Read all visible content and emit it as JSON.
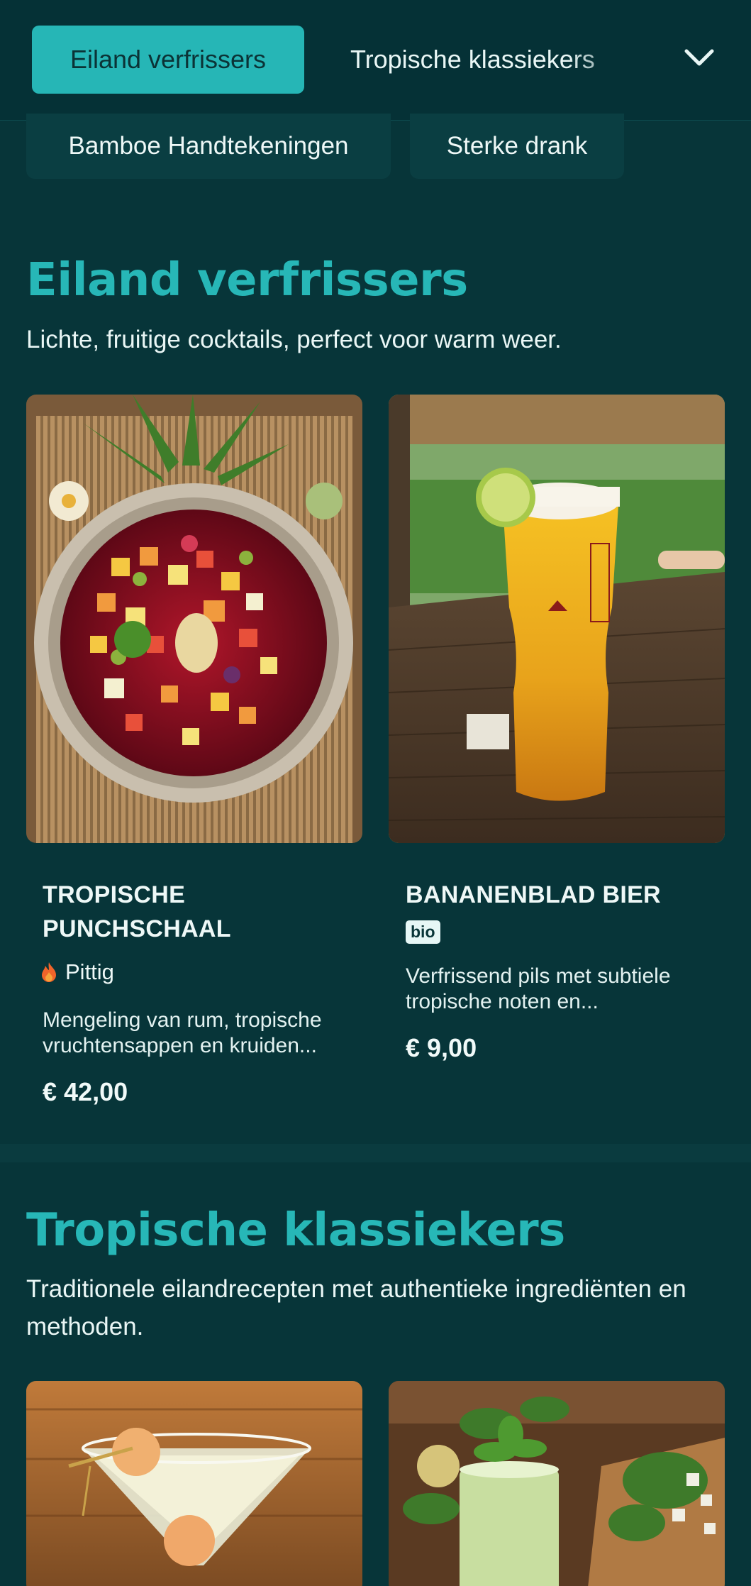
{
  "nav": {
    "active_tab": "Eiland verfrissers",
    "next_tab": "Tropische klassiekers",
    "chips": [
      "Bamboe Handtekeningen",
      "Sterke drank"
    ]
  },
  "sections": [
    {
      "title": "Eiland verfrissers",
      "description": "Lichte, fruitige cocktails, perfect voor warm weer.",
      "items": [
        {
          "name": "TROPISCHE PUNCHSCHAAL",
          "tag": "Pittig",
          "tag_icon": "flame-icon",
          "description": "Mengeling van rum, tropische vruchtensappen en kruiden...",
          "price": "€ 42,00"
        },
        {
          "name": "BANANENBLAD BIER",
          "badge": "bio",
          "description": "Verfrissend pils met subtiele tropische noten en...",
          "price": "€ 9,00"
        }
      ]
    },
    {
      "title": "Tropische klassiekers",
      "description": "Traditionele eilandrecepten met authentieke ingrediënten en methoden."
    }
  ],
  "colors": {
    "background": "#073539",
    "accent": "#26b6b6",
    "heading": "#27b7b7",
    "flame": "#f0642a"
  }
}
